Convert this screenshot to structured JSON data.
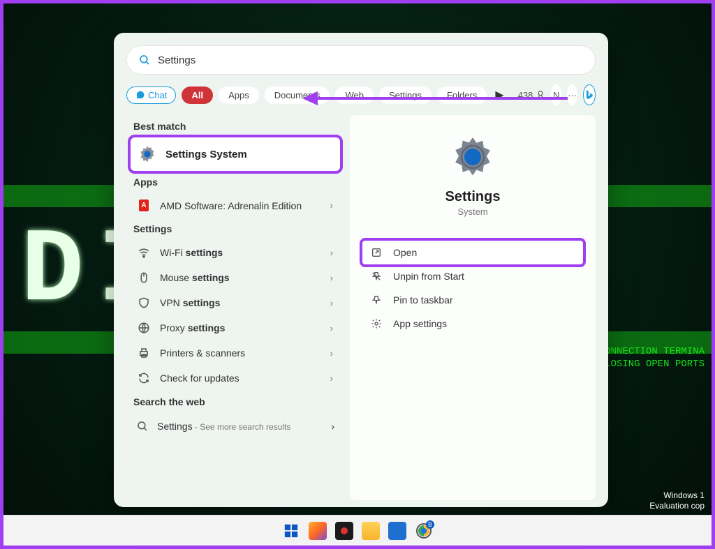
{
  "search": {
    "value": "Settings"
  },
  "filters": {
    "chat": "Chat",
    "all": "All",
    "apps": "Apps",
    "documents": "Documents",
    "web": "Web",
    "settings": "Settings",
    "folders": "Folders",
    "points": "438",
    "avatar_letter": "N"
  },
  "left": {
    "best_match_label": "Best match",
    "best_match": {
      "title": "Settings",
      "subtitle": "System"
    },
    "apps_label": "Apps",
    "apps": [
      {
        "title": "AMD Software: Adrenalin Edition"
      }
    ],
    "settings_label": "Settings",
    "settings": [
      {
        "prefix": "Wi-Fi ",
        "bold": "settings"
      },
      {
        "prefix": "Mouse ",
        "bold": "settings"
      },
      {
        "prefix": "VPN ",
        "bold": "settings"
      },
      {
        "prefix": "Proxy ",
        "bold": "settings"
      },
      {
        "prefix": "Printers & scanners",
        "bold": ""
      },
      {
        "prefix": "Check for updates",
        "bold": ""
      }
    ],
    "web_label": "Search the web",
    "web": {
      "term": "Settings",
      "more": " - See more search results"
    }
  },
  "preview": {
    "title": "Settings",
    "subtitle": "System",
    "actions": {
      "open": "Open",
      "unpin": "Unpin from Start",
      "pintaskbar": "Pin to taskbar",
      "appsettings": "App settings"
    }
  },
  "desktop": {
    "bg_big": "DI     D",
    "bg_line1": "CONNECTION TERMINA",
    "bg_line2": "CLOSING OPEN PORTS",
    "eval1": "Windows 1",
    "eval2": "Evaluation cop"
  }
}
